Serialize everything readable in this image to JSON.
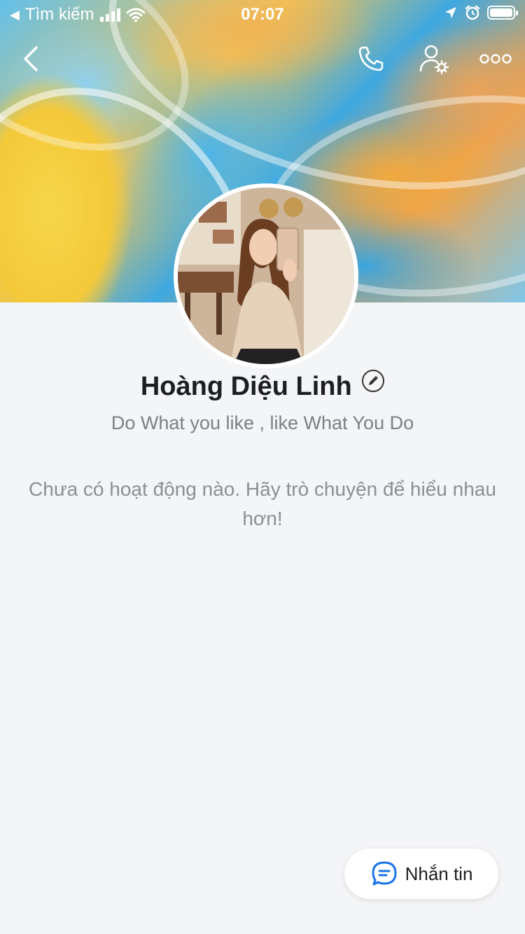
{
  "status_bar": {
    "back_app": "Tìm kiếm",
    "time": "07:07"
  },
  "profile": {
    "name": "Hoàng Diệu Linh",
    "status": "Do What you like , like What You Do"
  },
  "feed": {
    "empty_message": "Chưa có hoạt động nào. Hãy trò chuyện để hiểu nhau hơn!"
  },
  "actions": {
    "message_label": "Nhắn tin"
  },
  "colors": {
    "accent": "#1a73e8",
    "background": "#f4f5f7"
  },
  "icons": [
    "back-icon",
    "phone-icon",
    "user-settings-icon",
    "more-icon",
    "edit-icon",
    "chat-icon"
  ]
}
